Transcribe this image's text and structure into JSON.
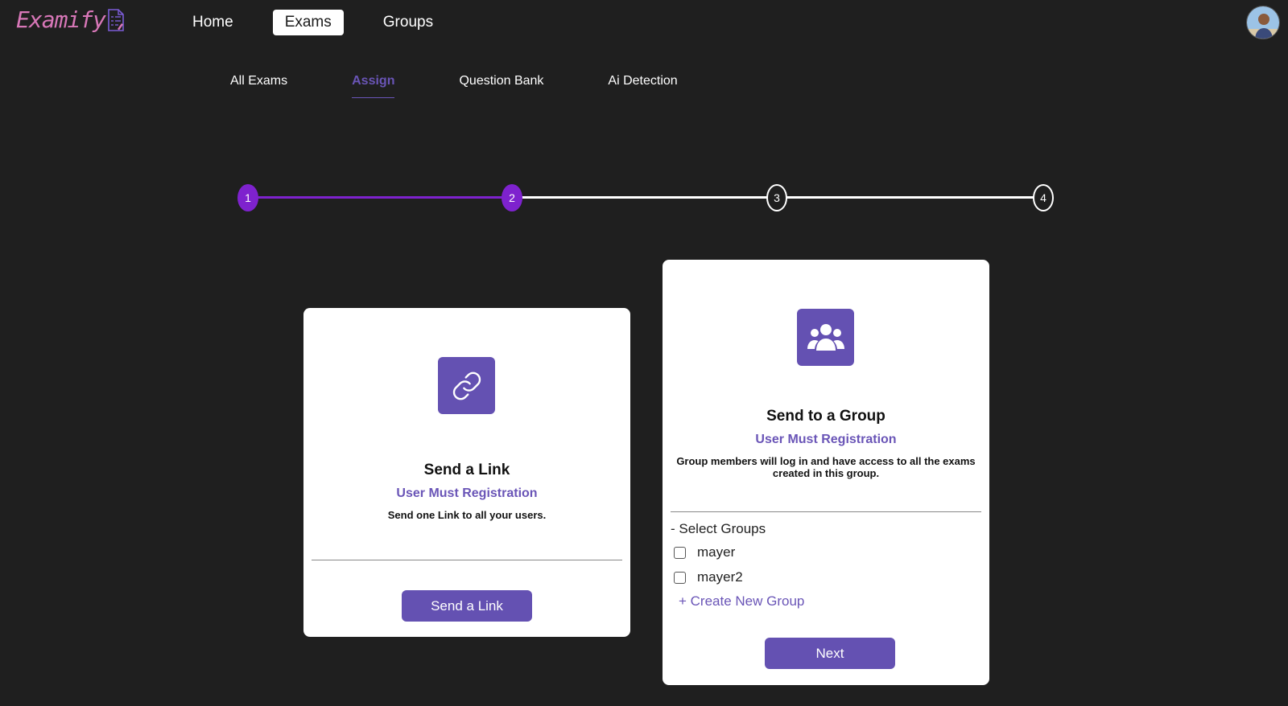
{
  "app": {
    "logo_text": "Examify",
    "brand_color": "#d877b8",
    "accent_color": "#6451b2"
  },
  "topnav": {
    "items": [
      {
        "label": "Home",
        "active": false
      },
      {
        "label": "Exams",
        "active": true
      },
      {
        "label": "Groups",
        "active": false
      }
    ],
    "avatar_icon": "user-avatar"
  },
  "subnav": {
    "items": [
      {
        "label": "All Exams",
        "active": false
      },
      {
        "label": "Assign",
        "active": true
      },
      {
        "label": "Question Bank",
        "active": false
      },
      {
        "label": "Ai Detection",
        "active": false
      }
    ]
  },
  "stepper": {
    "current_step": 2,
    "steps": [
      "1",
      "2",
      "3",
      "4"
    ],
    "done_color": "#7e22ce"
  },
  "link_card": {
    "icon": "link-icon",
    "title": "Send a Link",
    "subtitle": "User Must Registration",
    "description": "Send one Link to all your users.",
    "button_label": "Send a Link"
  },
  "group_card": {
    "icon": "users-group-icon",
    "title": "Send to a Group",
    "subtitle": "User Must Registration",
    "description": "Group members will log in and have access to all the exams created in this group.",
    "select_label": "- Select Groups",
    "groups": [
      {
        "name": "mayer",
        "checked": false
      },
      {
        "name": "mayer2",
        "checked": false
      }
    ],
    "create_label": "+ Create New Group",
    "button_label": "Next"
  }
}
